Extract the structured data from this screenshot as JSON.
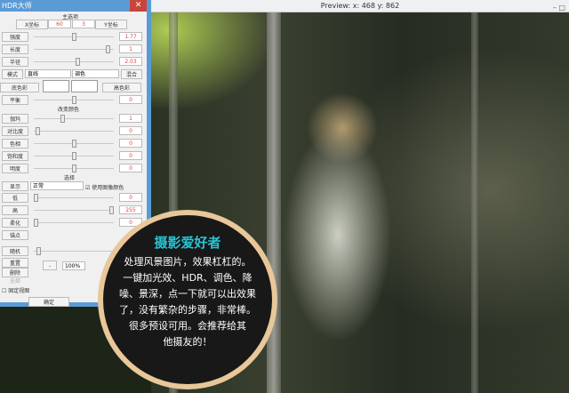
{
  "preview": {
    "title": "Preview:  x: 468 y: 862",
    "controls": "–  □"
  },
  "dialog": {
    "title": "HDR大师",
    "close": "✕",
    "main_options": "主选项",
    "tab_x": "X坐标",
    "x_val": "60",
    "y_val": "3",
    "tab_y": "Y坐标",
    "rows": [
      {
        "label": "强度",
        "value": "1.77",
        "pos": 0.5
      },
      {
        "label": "长度",
        "value": "1",
        "pos": 0.95
      },
      {
        "label": "半径",
        "value": "2.03",
        "pos": 0.55
      }
    ],
    "mode_label": "模式",
    "mode_value": "直线",
    "color_mode": "调色",
    "blend": "混合",
    "low_color": "底色彩",
    "high_color": "高色彩",
    "balance": {
      "label": "平衡",
      "value": "0",
      "pos": 0.5
    },
    "change_color": "改变颜色",
    "color_rows": [
      {
        "label": "伽玛",
        "value": "1",
        "pos": 0.35
      },
      {
        "label": "对比度",
        "value": "0",
        "pos": 0.02
      },
      {
        "label": "色相",
        "value": "0",
        "pos": 0.5
      },
      {
        "label": "饱和度",
        "value": "0",
        "pos": 0.5
      },
      {
        "label": "明度",
        "value": "0",
        "pos": 0.5
      }
    ],
    "selection": "选择",
    "display_label": "显示",
    "display_value": "正常",
    "use_image_color": "使用图像颜色",
    "sel_rows": [
      {
        "label": "低",
        "value": "0",
        "pos": 0.0
      },
      {
        "label": "高",
        "value": "255",
        "pos": 1.0
      },
      {
        "label": "柔化",
        "value": "0",
        "pos": 0.0
      }
    ],
    "anchor": "锚点",
    "random": "随机",
    "reset": "重置",
    "delete": "删除",
    "all": "全部",
    "minus": "-",
    "zoom": "100%",
    "fixed_view": "固定视图",
    "ok": "确定"
  },
  "overlay": {
    "title": "摄影爱好者",
    "lines": [
      "处理风景图片，效果杠杠的。",
      "一键加光效、HDR、调色、降",
      "噪、景深，点一下就可以出效果",
      "了，没有繁杂的步骤，非常棒。",
      "很多预设可用。会推荐给其",
      "他摄友的！"
    ]
  }
}
